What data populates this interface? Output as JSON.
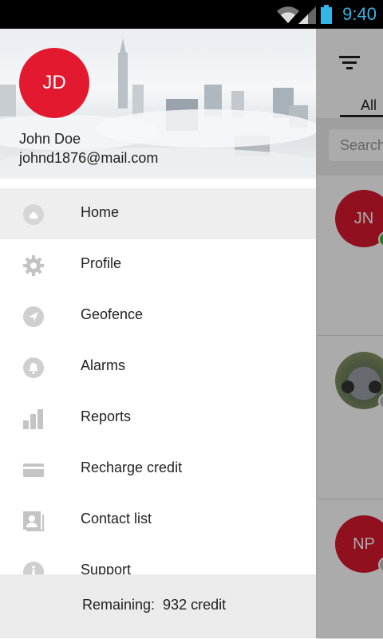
{
  "status_bar": {
    "time": "9:40"
  },
  "app": {
    "tab_all": "All",
    "search_placeholder": "Search",
    "contacts": [
      {
        "initials": "JN",
        "status_color": "#2fb53c"
      },
      {
        "initials": "",
        "status_color": "#bdbdbd"
      },
      {
        "initials": "NP",
        "status_color": "#bdbdbd"
      }
    ]
  },
  "drawer": {
    "user": {
      "initials": "JD",
      "name": "John Doe",
      "email": "johnd1876@mail.com"
    },
    "menu": [
      {
        "label": "Home",
        "icon": "home-icon"
      },
      {
        "label": "Profile",
        "icon": "gear-icon"
      },
      {
        "label": "Geofence",
        "icon": "navigation-icon"
      },
      {
        "label": "Alarms",
        "icon": "bell-icon"
      },
      {
        "label": "Reports",
        "icon": "bar-chart-icon"
      },
      {
        "label": "Recharge credit",
        "icon": "credit-card-icon"
      },
      {
        "label": "Contact list",
        "icon": "contacts-icon"
      },
      {
        "label": "Support",
        "icon": "info-icon"
      }
    ],
    "footer": {
      "remaining": "Remaining:  932 credit"
    }
  },
  "colors": {
    "accent": "#e3192f",
    "icon_gray": "#bdbdbd"
  }
}
